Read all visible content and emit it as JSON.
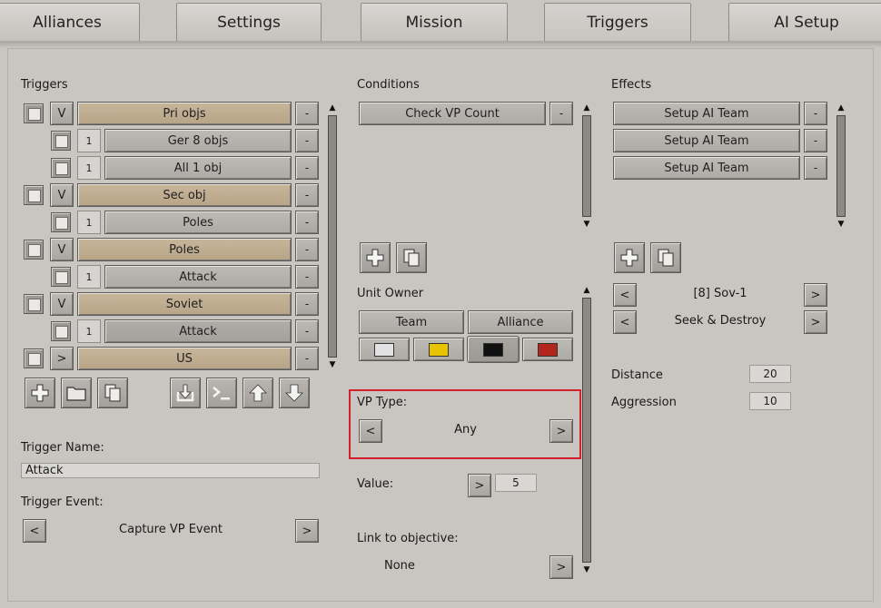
{
  "tabs": [
    {
      "label": "Alliances"
    },
    {
      "label": "Settings"
    },
    {
      "label": "Mission"
    },
    {
      "label": "Triggers",
      "active": true
    },
    {
      "label": "AI Setup"
    }
  ],
  "triggers": {
    "heading": "Triggers",
    "rows": [
      {
        "type": "V",
        "label": "Pri objs"
      },
      {
        "count": "1",
        "label": "Ger 8 objs"
      },
      {
        "count": "1",
        "label": "All 1 obj"
      },
      {
        "type": "V",
        "label": "Sec obj"
      },
      {
        "count": "1",
        "label": "Poles"
      },
      {
        "type": "V",
        "label": "Poles"
      },
      {
        "count": "1",
        "label": "Attack"
      },
      {
        "type": "V",
        "label": "Soviet"
      },
      {
        "count": "1",
        "label": "Attack"
      },
      {
        "type": ">",
        "label": "US"
      }
    ],
    "remove_label": "-",
    "name_label": "Trigger Name:",
    "name_value": "Attack",
    "event_label": "Trigger Event:",
    "event_value": "Capture VP Event",
    "prev": "<",
    "next": ">"
  },
  "conditions": {
    "heading": "Conditions",
    "items": [
      {
        "label": "Check VP Count"
      }
    ],
    "remove_label": "-",
    "unit_owner_label": "Unit Owner",
    "owner_tabs": [
      "Team",
      "Alliance"
    ],
    "swatch_colors": [
      "#e2e2e2",
      "#e8c400",
      "#111111",
      "#b3261e"
    ],
    "vp_type_label": "VP Type:",
    "vp_type_value": "Any",
    "value_label": "Value:",
    "value": "5",
    "link_label": "Link to objective:",
    "link_value": "None",
    "prev": "<",
    "next": ">"
  },
  "effects": {
    "heading": "Effects",
    "items": [
      {
        "label": "Setup AI Team"
      },
      {
        "label": "Setup AI Team"
      },
      {
        "label": "Setup AI Team"
      }
    ],
    "remove_label": "-",
    "team_value": "[8] Sov-1",
    "mode_value": "Seek & Destroy",
    "distance_label": "Distance",
    "distance": "20",
    "aggression_label": "Aggression",
    "aggression": "10",
    "prev": "<",
    "next": ">"
  },
  "icons": [
    "plus-icon",
    "folder-icon",
    "copy-icon",
    "import-icon",
    "console-icon",
    "arrow-up-icon",
    "arrow-down-icon"
  ],
  "highlight_color": "#d4202a"
}
